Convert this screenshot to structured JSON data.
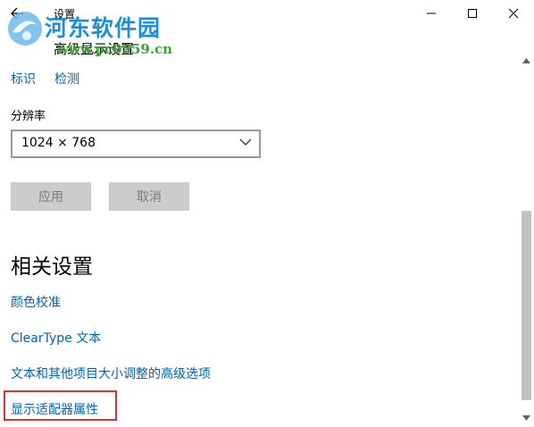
{
  "titlebar": {
    "app_title": "设置",
    "minimize_icon": "minimize-icon",
    "maximize_icon": "maximize-icon",
    "close_icon": "close-icon",
    "back_icon": "back-arrow-icon"
  },
  "watermark": {
    "name": "河东软件园",
    "url": "www.pc0359.cn"
  },
  "page": {
    "title": "高级显示设置"
  },
  "top_links": {
    "identify": "标识",
    "detect": "检测"
  },
  "resolution": {
    "label": "分辨率",
    "value": "1024 × 768"
  },
  "buttons": {
    "apply": "应用",
    "cancel": "取消"
  },
  "related": {
    "title": "相关设置",
    "links": [
      "颜色校准",
      "ClearType 文本",
      "文本和其他项目大小调整的高级选项",
      "显示适配器属性"
    ]
  },
  "colors": {
    "link": "#0063b1",
    "highlight": "#e03030",
    "button_bg": "#cccccc"
  }
}
